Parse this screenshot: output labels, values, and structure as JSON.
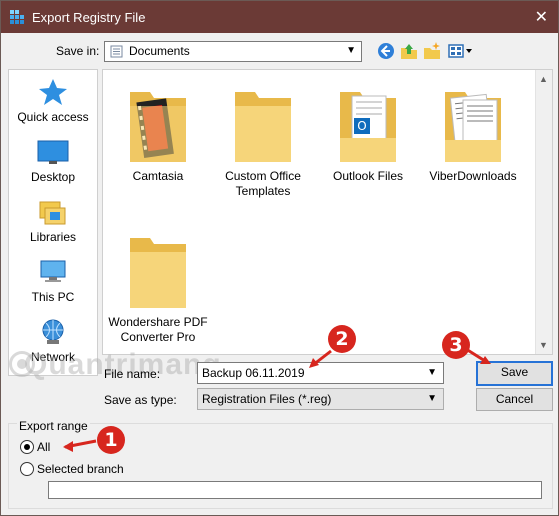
{
  "window": {
    "title": "Export Registry File",
    "close_glyph": "✕"
  },
  "toolbar": {
    "save_in_label": "Save in:",
    "save_in_value": "Documents",
    "buttons": [
      "back-icon",
      "up-folder-icon",
      "new-folder-icon",
      "view-menu-icon"
    ]
  },
  "places": [
    {
      "label": "Quick access",
      "icon": "star-icon"
    },
    {
      "label": "Desktop",
      "icon": "desktop-icon"
    },
    {
      "label": "Libraries",
      "icon": "libraries-icon"
    },
    {
      "label": "This PC",
      "icon": "computer-icon"
    },
    {
      "label": "Network",
      "icon": "network-icon"
    }
  ],
  "files": [
    {
      "name_lines": [
        "Camtasia"
      ],
      "icon": "folder-video-icon"
    },
    {
      "name_lines": [
        "Custom Office",
        "Templates"
      ],
      "icon": "folder-icon"
    },
    {
      "name_lines": [
        "Outlook Files"
      ],
      "icon": "folder-outlook-icon"
    },
    {
      "name_lines": [
        "ViberDownloads"
      ],
      "icon": "folder-documents-icon"
    },
    {
      "name_lines": [
        "Wondershare PDF",
        "Converter Pro"
      ],
      "icon": "folder-icon"
    }
  ],
  "form": {
    "file_name_label": "File name:",
    "file_name_value": "Backup 06.11.2019",
    "save_as_type_label": "Save as type:",
    "save_as_type_value": "Registration Files (*.reg)",
    "save_button": "Save",
    "cancel_button": "Cancel"
  },
  "export_range": {
    "title": "Export range",
    "all_label": "All",
    "selected_branch_label": "Selected branch",
    "branch_value": "",
    "selected": "All"
  },
  "annotations": {
    "badge1": "1",
    "badge2": "2",
    "badge3": "3",
    "color": "#d7261e"
  },
  "watermark": "Quantrimang"
}
